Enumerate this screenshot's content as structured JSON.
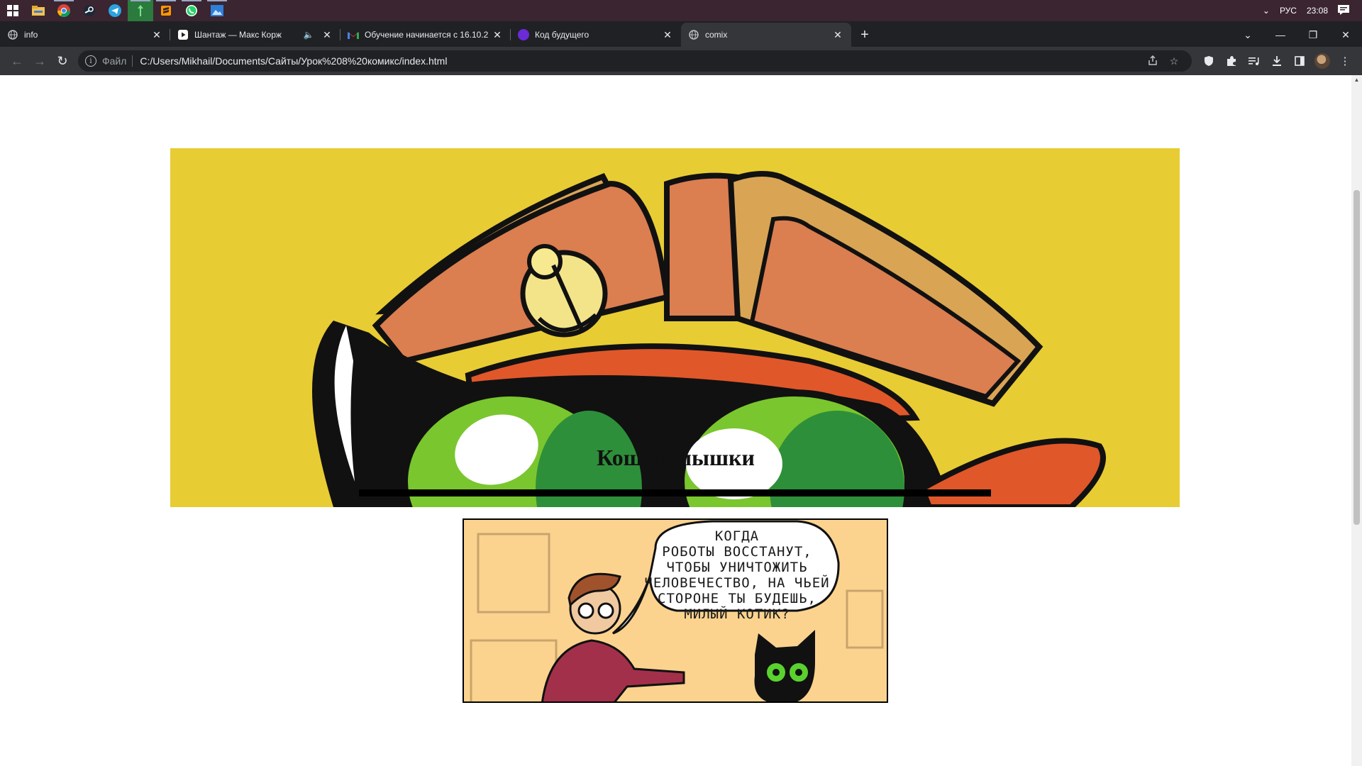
{
  "taskbar": {
    "apps": [
      "windows-start-icon",
      "file-explorer-icon",
      "chrome-icon",
      "steam-icon",
      "telegram-icon",
      "notepad-plus-icon",
      "sublime-icon",
      "whatsapp-icon",
      "photo-icon"
    ],
    "language": "РУС",
    "time": "23:08"
  },
  "tabs": [
    {
      "title": "info",
      "icon": "globe-icon"
    },
    {
      "title": "Шантаж — Макс Корж",
      "icon": "play-icon",
      "muted": true
    },
    {
      "title": "Обучение начинается с 16.10.2",
      "icon": "gmail-icon"
    },
    {
      "title": "Код будущего",
      "icon": "mnogo-icon"
    },
    {
      "title": "comix",
      "icon": "globe-icon",
      "active": true
    }
  ],
  "omnibox": {
    "scheme_label": "Файл",
    "url": "C:/Users/Mikhail/Documents/Сайты/Урок%208%20комикс/index.html"
  },
  "page": {
    "title": "Кошки-мышки",
    "speech_bubble": "КОГДА\nРОБОТЫ ВОССТАНУТ,\nЧТОБЫ УНИЧТОЖИТЬ\nЧЕЛОВЕЧЕСТВО, НА ЧЬЕЙ\nСТОРОНЕ ТЫ БУДЕШЬ,\nМИЛЫЙ КОТИК?"
  },
  "colors": {
    "hero_bg": "#e8cc33",
    "panel_bg": "#fbd38f",
    "cat_eye": "#7ac62e",
    "cap": "#d97c4f"
  }
}
